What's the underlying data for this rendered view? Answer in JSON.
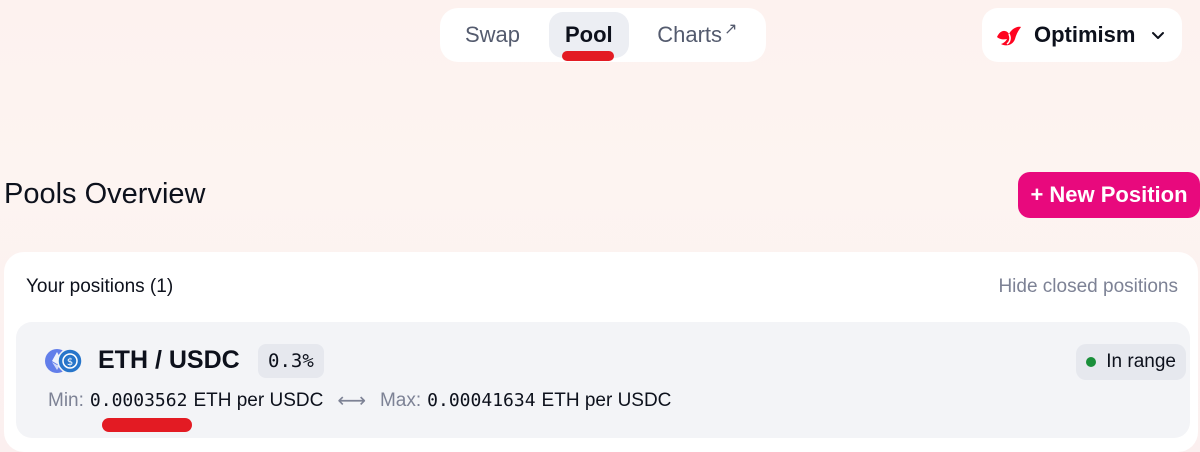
{
  "nav": {
    "items": [
      {
        "label": "Swap"
      },
      {
        "label": "Pool",
        "active": true
      },
      {
        "label": "Charts",
        "external_icon": "arrow-up-right-icon"
      }
    ]
  },
  "network": {
    "label": "Optimism",
    "icon": "optimism-logo-icon",
    "chevron": "chevron-down-icon"
  },
  "page": {
    "title": "Pools Overview"
  },
  "new_position": {
    "label": "+ New Position",
    "color": "#e8097d"
  },
  "positions": {
    "header": "Your positions (1)",
    "hide_closed": "Hide closed positions",
    "items": [
      {
        "pair": "ETH / USDC",
        "fee": "0.3%",
        "status": "In range",
        "status_color": "#1a8f3a",
        "min_label": "Min:",
        "min_value": "0.0003562",
        "min_unit": "ETH per USDC",
        "max_label": "Max:",
        "max_value": "0.00041634",
        "max_unit": "ETH per USDC"
      }
    ]
  },
  "annotations": {
    "highlight_color": "#e31b23"
  }
}
